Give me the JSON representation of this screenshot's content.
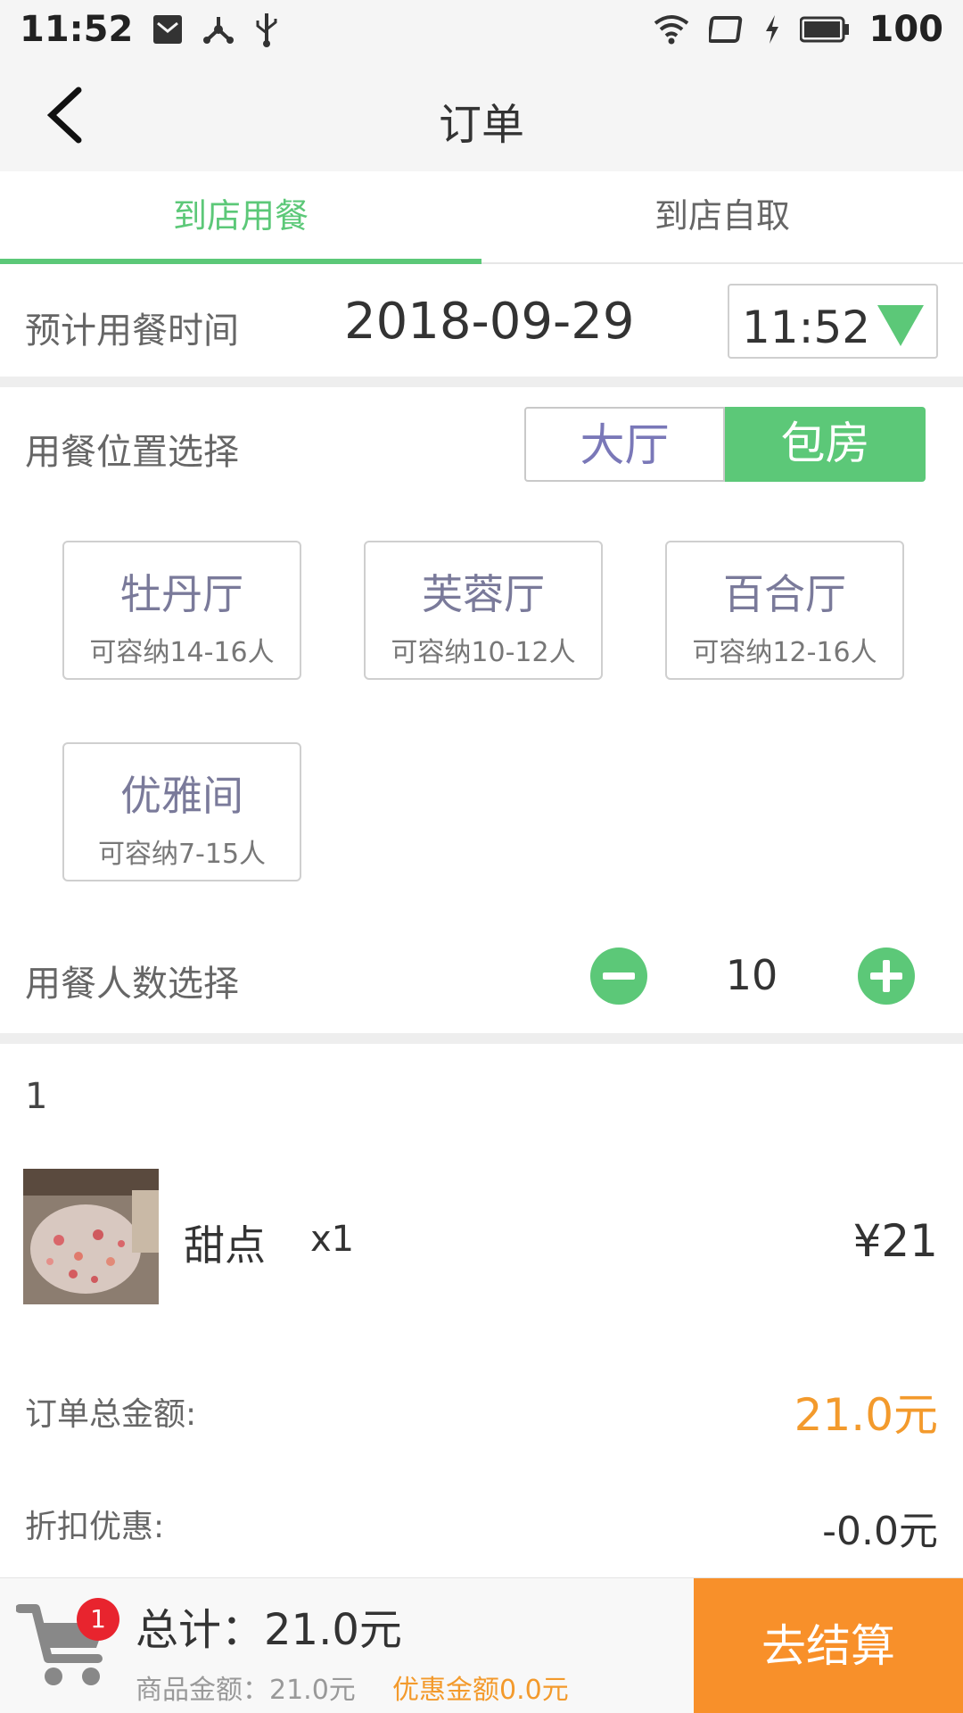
{
  "status_bar": {
    "time": "11:52",
    "battery": "100"
  },
  "header": {
    "title": "订单"
  },
  "tabs": [
    {
      "label": "到店用餐",
      "active": true
    },
    {
      "label": "到店自取",
      "active": false
    }
  ],
  "dining_time": {
    "label": "预计用餐时间",
    "date": "2018-09-29",
    "time": "11:52"
  },
  "location": {
    "label": "用餐位置选择",
    "options": [
      "大厅",
      "包房"
    ],
    "selected": "包房"
  },
  "rooms": [
    {
      "name": "牡丹厅",
      "capacity": "可容纳14-16人"
    },
    {
      "name": "芙蓉厅",
      "capacity": "可容纳10-12人"
    },
    {
      "name": "百合厅",
      "capacity": "可容纳12-16人"
    },
    {
      "name": "优雅间",
      "capacity": "可容纳7-15人"
    }
  ],
  "people": {
    "label": "用餐人数选择",
    "count": "10"
  },
  "order": {
    "index": "1",
    "item": {
      "name": "甜点",
      "qty": "x1",
      "price": "¥21"
    },
    "total_label": "订单总金额:",
    "total_value": "21.0元",
    "discount_label": "折扣优惠:",
    "discount_value": "-0.0元"
  },
  "bottom": {
    "cart_badge": "1",
    "sum": "总计：21.0元",
    "goods_amount": "商品金额：21.0元",
    "discount_amount": "优惠金额0.0元",
    "checkout": "去结算"
  },
  "colors": {
    "accent": "#5cc878",
    "orange": "#f8902a",
    "price": "#f39a2c",
    "badge": "#e8242e"
  }
}
